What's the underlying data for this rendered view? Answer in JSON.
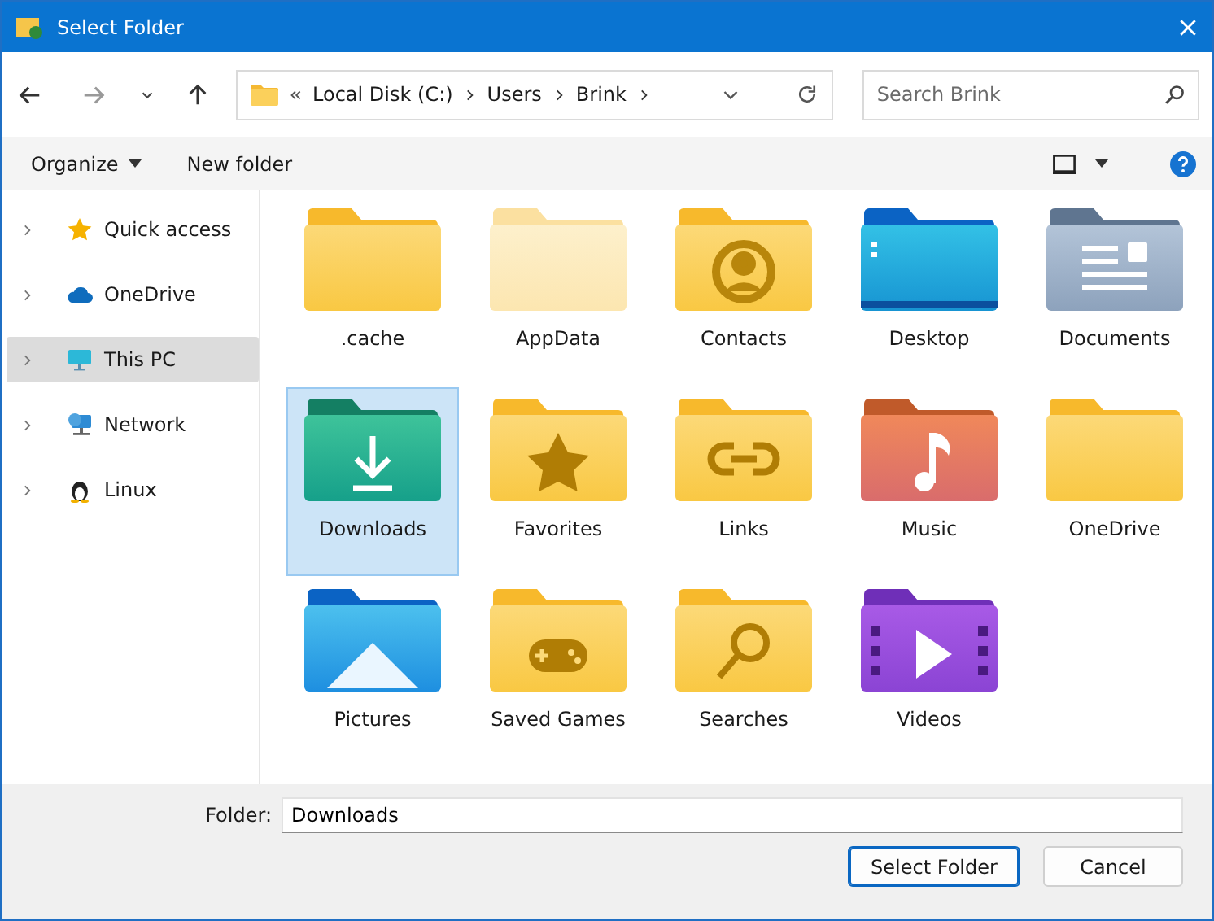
{
  "window": {
    "title": "Select Folder"
  },
  "breadcrumb": [
    "Local Disk (C:)",
    "Users",
    "Brink"
  ],
  "search": {
    "placeholder": "Search Brink"
  },
  "toolbar": {
    "organize": "Organize",
    "new_folder": "New folder"
  },
  "sidebar": {
    "items": [
      {
        "label": "Quick access",
        "kind": "star",
        "selected": false
      },
      {
        "label": "OneDrive",
        "kind": "cloud",
        "selected": false
      },
      {
        "label": "This PC",
        "kind": "monitor",
        "selected": true
      },
      {
        "label": "Network",
        "kind": "network",
        "selected": false
      },
      {
        "label": "Linux",
        "kind": "penguin",
        "selected": false
      }
    ]
  },
  "folders": [
    {
      "name": ".cache",
      "kind": "plain",
      "selected": false
    },
    {
      "name": "AppData",
      "kind": "faded",
      "selected": false
    },
    {
      "name": "Contacts",
      "kind": "person",
      "selected": false
    },
    {
      "name": "Desktop",
      "kind": "desktop",
      "selected": false
    },
    {
      "name": "Documents",
      "kind": "document",
      "selected": false
    },
    {
      "name": "Downloads",
      "kind": "download",
      "selected": true
    },
    {
      "name": "Favorites",
      "kind": "star",
      "selected": false
    },
    {
      "name": "Links",
      "kind": "link",
      "selected": false
    },
    {
      "name": "Music",
      "kind": "music",
      "selected": false
    },
    {
      "name": "OneDrive",
      "kind": "plain",
      "selected": false
    },
    {
      "name": "Pictures",
      "kind": "picture",
      "selected": false
    },
    {
      "name": "Saved Games",
      "kind": "gamepad",
      "selected": false
    },
    {
      "name": "Searches",
      "kind": "magnifier",
      "selected": false
    },
    {
      "name": "Videos",
      "kind": "video",
      "selected": false
    }
  ],
  "folder_field": {
    "label": "Folder:",
    "value": "Downloads"
  },
  "buttons": [
    {
      "label": "Select Folder",
      "kind": "primary"
    },
    {
      "label": "Cancel",
      "kind": "secondary"
    }
  ]
}
